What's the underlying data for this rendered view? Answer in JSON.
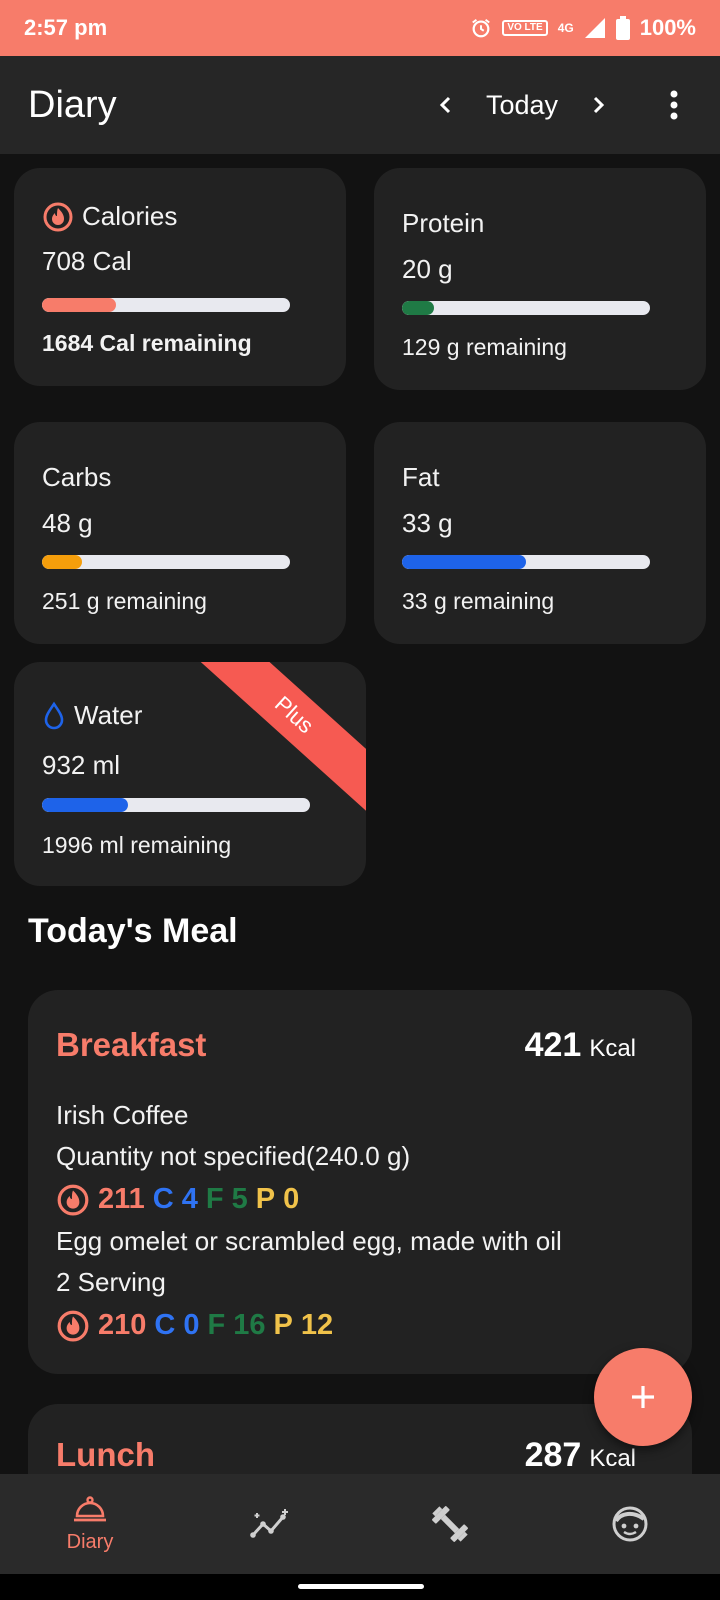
{
  "status_bar": {
    "time": "2:57 pm",
    "volte": "VO LTE",
    "network": "4G",
    "battery": "100%"
  },
  "app_bar": {
    "title": "Diary",
    "date_label": "Today"
  },
  "colors": {
    "accent": "#f77c6a",
    "protein": "#1f7a45",
    "carbs": "#f59e0b",
    "fat": "#1e63e9",
    "water": "#1e63e9",
    "plus_ribbon": "#f65a52"
  },
  "nutrients": {
    "calories": {
      "label": "Calories",
      "value": "708 Cal",
      "remaining": "1684 Cal remaining",
      "progress_pct": 30
    },
    "protein": {
      "label": "Protein",
      "value": "20 g",
      "remaining": "129 g remaining",
      "progress_pct": 13
    },
    "carbs": {
      "label": "Carbs",
      "value": "48 g",
      "remaining": "251 g remaining",
      "progress_pct": 16
    },
    "fat": {
      "label": "Fat",
      "value": "33 g",
      "remaining": "33 g remaining",
      "progress_pct": 50
    },
    "water": {
      "label": "Water",
      "value": "932 ml",
      "remaining": "1996 ml remaining",
      "progress_pct": 32,
      "badge": "Plus"
    }
  },
  "meals_section": {
    "title": "Today's Meal"
  },
  "meals": [
    {
      "name": "Breakfast",
      "kcal": "421",
      "kcal_unit": "Kcal",
      "items": [
        {
          "name": "Irish Coffee",
          "quantity": "Quantity not specified(240.0 g)",
          "cal": "211",
          "c": "4",
          "f": "5",
          "p": "0"
        },
        {
          "name": "Egg omelet or scrambled egg, made with oil",
          "quantity": "2 Serving",
          "cal": "210",
          "c": "0",
          "f": "16",
          "p": "12"
        }
      ]
    },
    {
      "name": "Lunch",
      "kcal": "287",
      "kcal_unit": "Kcal"
    }
  ],
  "macro_letters": {
    "c": "C",
    "f": "F",
    "p": "P"
  },
  "bottom_nav": {
    "diary": "Diary"
  }
}
